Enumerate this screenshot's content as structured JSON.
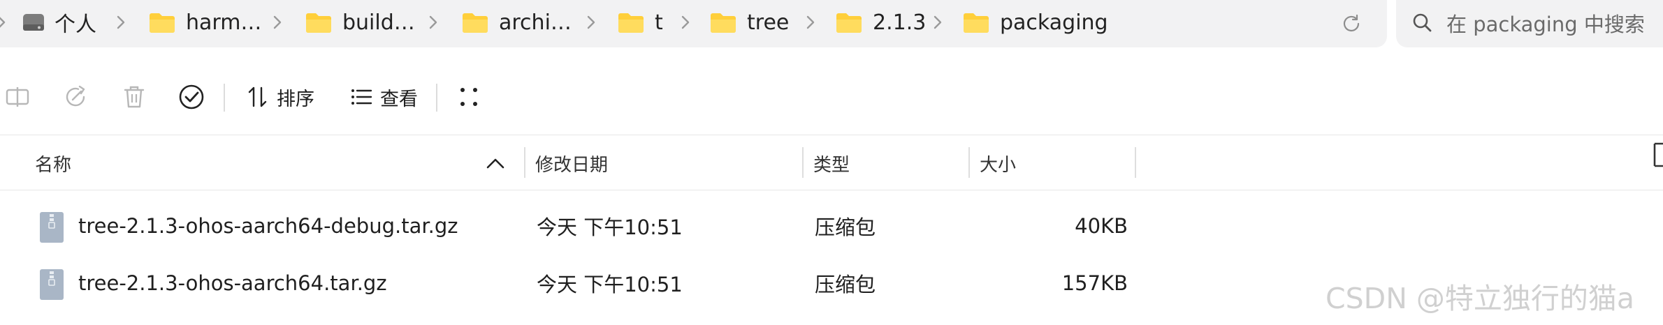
{
  "address_bar": {
    "root_label": "个人",
    "crumbs": [
      "harm…",
      "build…",
      "archi…",
      "t",
      "tree",
      "2.1.3",
      "packaging"
    ]
  },
  "search": {
    "placeholder": "在 packaging 中搜索"
  },
  "toolbar": {
    "sort_label": "排序",
    "view_label": "查看"
  },
  "table": {
    "columns": {
      "name": "名称",
      "modified": "修改日期",
      "type": "类型",
      "size": "大小"
    },
    "rows": [
      {
        "name": "tree-2.1.3-ohos-aarch64-debug.tar.gz",
        "modified": "今天 下午10:51",
        "type": "压缩包",
        "size": "40KB"
      },
      {
        "name": "tree-2.1.3-ohos-aarch64.tar.gz",
        "modified": "今天 下午10:51",
        "type": "压缩包",
        "size": "157KB"
      }
    ]
  },
  "watermark": "CSDN @特立独行的猫a",
  "icons": {
    "drive": "drive-icon",
    "folder": "folder-icon",
    "chevron": "chevron-right-icon",
    "refresh": "refresh-icon",
    "search": "search-icon",
    "file": "archive-file-icon"
  },
  "colors": {
    "folder": "#ffcf3a",
    "file": "#a9b6c6",
    "bar_bg": "#f2f2f3"
  }
}
